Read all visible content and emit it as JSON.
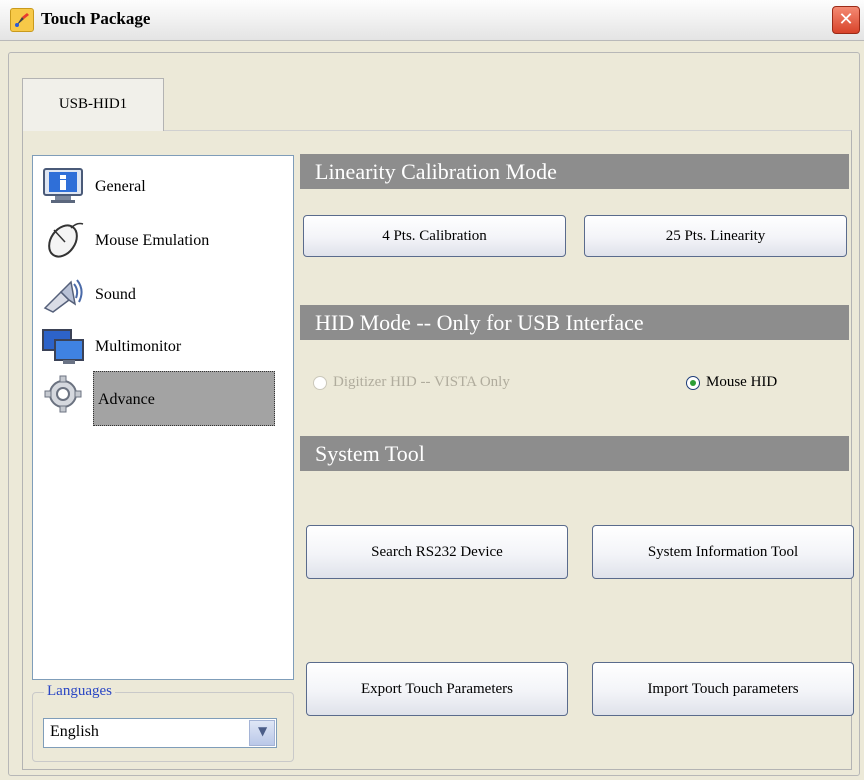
{
  "window": {
    "title": "Touch Package",
    "close_label": "✕"
  },
  "tabs": [
    "USB-HID1"
  ],
  "sidebar": {
    "items": [
      {
        "label": "General",
        "icon": "info-icon"
      },
      {
        "label": "Mouse Emulation",
        "icon": "mouse-icon"
      },
      {
        "label": "Sound",
        "icon": "speaker-icon"
      },
      {
        "label": "Multimonitor",
        "icon": "monitors-icon"
      },
      {
        "label": "Advance",
        "icon": "gear-icon",
        "selected": true
      }
    ]
  },
  "languages": {
    "legend": "Languages",
    "selected": "English"
  },
  "linearity": {
    "header": "Linearity Calibration Mode",
    "btn_4pts": "4 Pts. Calibration",
    "btn_25pts": "25 Pts. Linearity"
  },
  "hid_mode": {
    "header": "HID Mode -- Only for USB Interface",
    "digitizer_label": "Digitizer HID -- VISTA Only",
    "digitizer_enabled": false,
    "mouse_label": "Mouse HID",
    "mouse_checked": true
  },
  "system_tool": {
    "header": "System Tool",
    "search_rs232": "Search RS232 Device",
    "sys_info": "System Information Tool",
    "export_params": "Export Touch Parameters",
    "import_params": "Import Touch parameters"
  },
  "colors": {
    "section_header_bg": "#8d8d8d",
    "selected_item_bg": "#a3a3a3",
    "window_bg": "#ece9d8",
    "close_button": "#d8432a"
  }
}
